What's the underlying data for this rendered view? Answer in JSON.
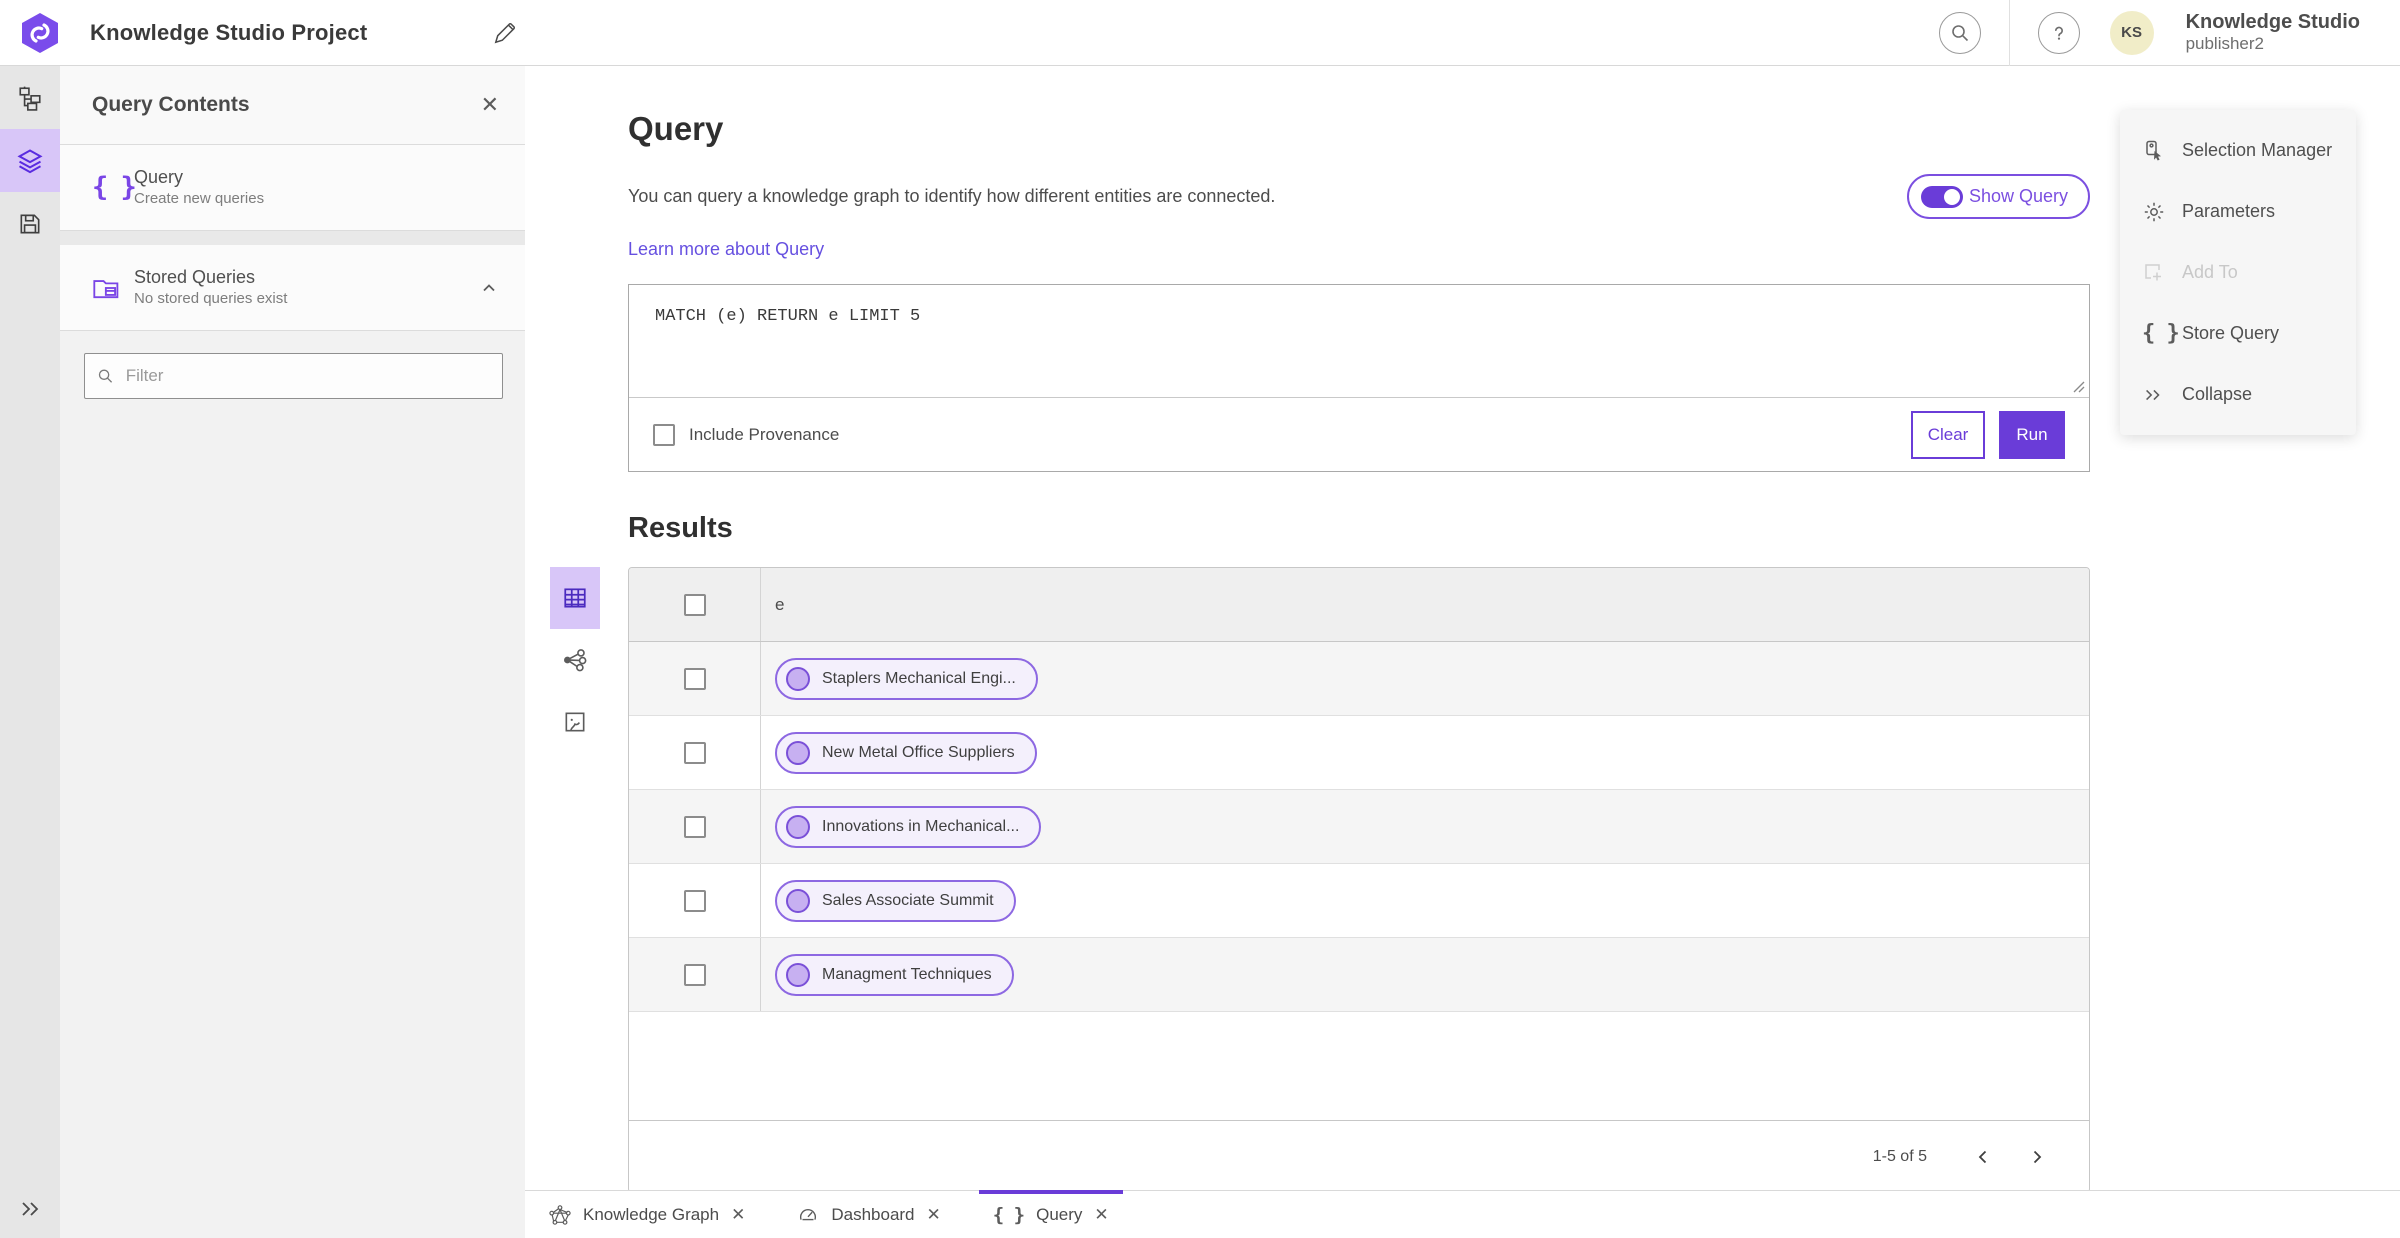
{
  "topbar": {
    "title": "Knowledge Studio Project",
    "user_name": "Knowledge Studio",
    "user_role": "publisher2",
    "avatar_initials": "KS"
  },
  "panel": {
    "title": "Query Contents",
    "items": [
      {
        "title": "Query",
        "subtitle": "Create new queries"
      },
      {
        "title": "Stored Queries",
        "subtitle": "No stored queries exist"
      }
    ],
    "filter_placeholder": "Filter"
  },
  "query": {
    "heading": "Query",
    "description": "You can query a knowledge graph to identify how different entities are connected.",
    "learn_more": "Learn more about Query",
    "show_query_label": "Show Query",
    "query_text": "MATCH (e) RETURN e LIMIT 5",
    "include_provenance_label": "Include Provenance",
    "clear_label": "Clear",
    "run_label": "Run"
  },
  "results": {
    "heading": "Results",
    "column_header": "e",
    "rows": [
      {
        "label": "Staplers Mechanical Engi..."
      },
      {
        "label": "New Metal Office Suppliers"
      },
      {
        "label": "Innovations in Mechanical..."
      },
      {
        "label": "Sales Associate Summit"
      },
      {
        "label": "Managment Techniques"
      }
    ],
    "pagination": "1-5 of 5"
  },
  "tool_menu": {
    "items": [
      {
        "label": "Selection Manager",
        "icon": "selection-manager-icon",
        "disabled": false
      },
      {
        "label": "Parameters",
        "icon": "gear-icon",
        "disabled": false
      },
      {
        "label": "Add To",
        "icon": "add-to-icon",
        "disabled": true
      },
      {
        "label": "Store Query",
        "icon": "curly-braces-icon",
        "disabled": false
      },
      {
        "label": "Collapse",
        "icon": "double-chevron-right-icon",
        "disabled": false
      }
    ]
  },
  "tabs": [
    {
      "label": "Knowledge Graph",
      "icon": "knowledge-graph-icon",
      "active": false
    },
    {
      "label": "Dashboard",
      "icon": "dashboard-icon",
      "active": false
    },
    {
      "label": "Query",
      "icon": "curly-braces-icon",
      "active": true
    }
  ],
  "colors": {
    "accent_purple": "#6a3cd8",
    "accent_light": "#d8c6f8",
    "toggle_outline": "#7b4fe0",
    "link_purple": "#6650e0",
    "pill_border": "#8d68e2",
    "pill_background": "#f4f0fc",
    "avatar_background": "#f1edc8",
    "rail_background": "#e6e6e6",
    "panel_background": "#f2f2f2",
    "table_header_background": "#efefef"
  }
}
